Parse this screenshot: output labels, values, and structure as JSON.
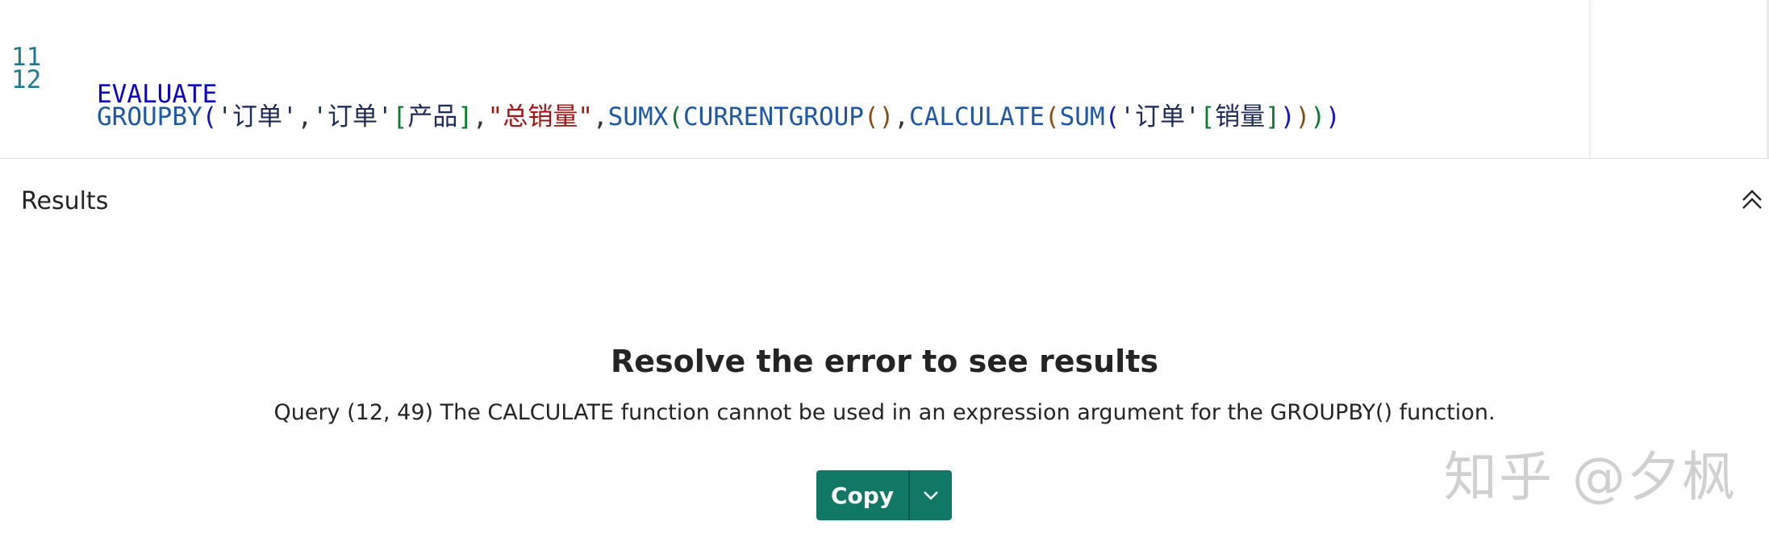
{
  "editor": {
    "lines": [
      {
        "number": "11",
        "tokens": [
          {
            "text": "EVALUATE"
          }
        ]
      },
      {
        "number": "12",
        "tokens": [
          {
            "text": "GROUPBY"
          },
          {
            "text": "("
          },
          {
            "text": "'订单'"
          },
          {
            "text": ","
          },
          {
            "text": "'订单'"
          },
          {
            "text": "["
          },
          {
            "text": "产品"
          },
          {
            "text": "]"
          },
          {
            "text": ","
          },
          {
            "text": "\"总销量\""
          },
          {
            "text": ","
          },
          {
            "text": "SUMX"
          },
          {
            "text": "("
          },
          {
            "text": "CURRENTGROUP"
          },
          {
            "text": "()"
          },
          {
            "text": ","
          },
          {
            "text": "CALCULATE"
          },
          {
            "text": "("
          },
          {
            "text": "SUM"
          },
          {
            "text": "("
          },
          {
            "text": "'订单'"
          },
          {
            "text": "["
          },
          {
            "text": "销量"
          },
          {
            "text": "]"
          },
          {
            "text": ")"
          },
          {
            "text": ")"
          },
          {
            "text": ")"
          },
          {
            "text": ")"
          }
        ]
      }
    ]
  },
  "results": {
    "title": "Results",
    "error_title": "Resolve the error to see results",
    "error_message": "Query (12, 49) The CALCULATE function cannot be used in an expression argument for the GROUPBY() function.",
    "copy_label": "Copy"
  },
  "watermark": "知乎 @夕枫",
  "icons": {
    "collapse": "chevron-double-up-icon",
    "dropdown": "chevron-down-icon"
  },
  "colors": {
    "accent": "#117865",
    "line_number": "#237893",
    "keyword": "#0a00c8",
    "function": "#1e56a8",
    "string": "#a31515"
  }
}
